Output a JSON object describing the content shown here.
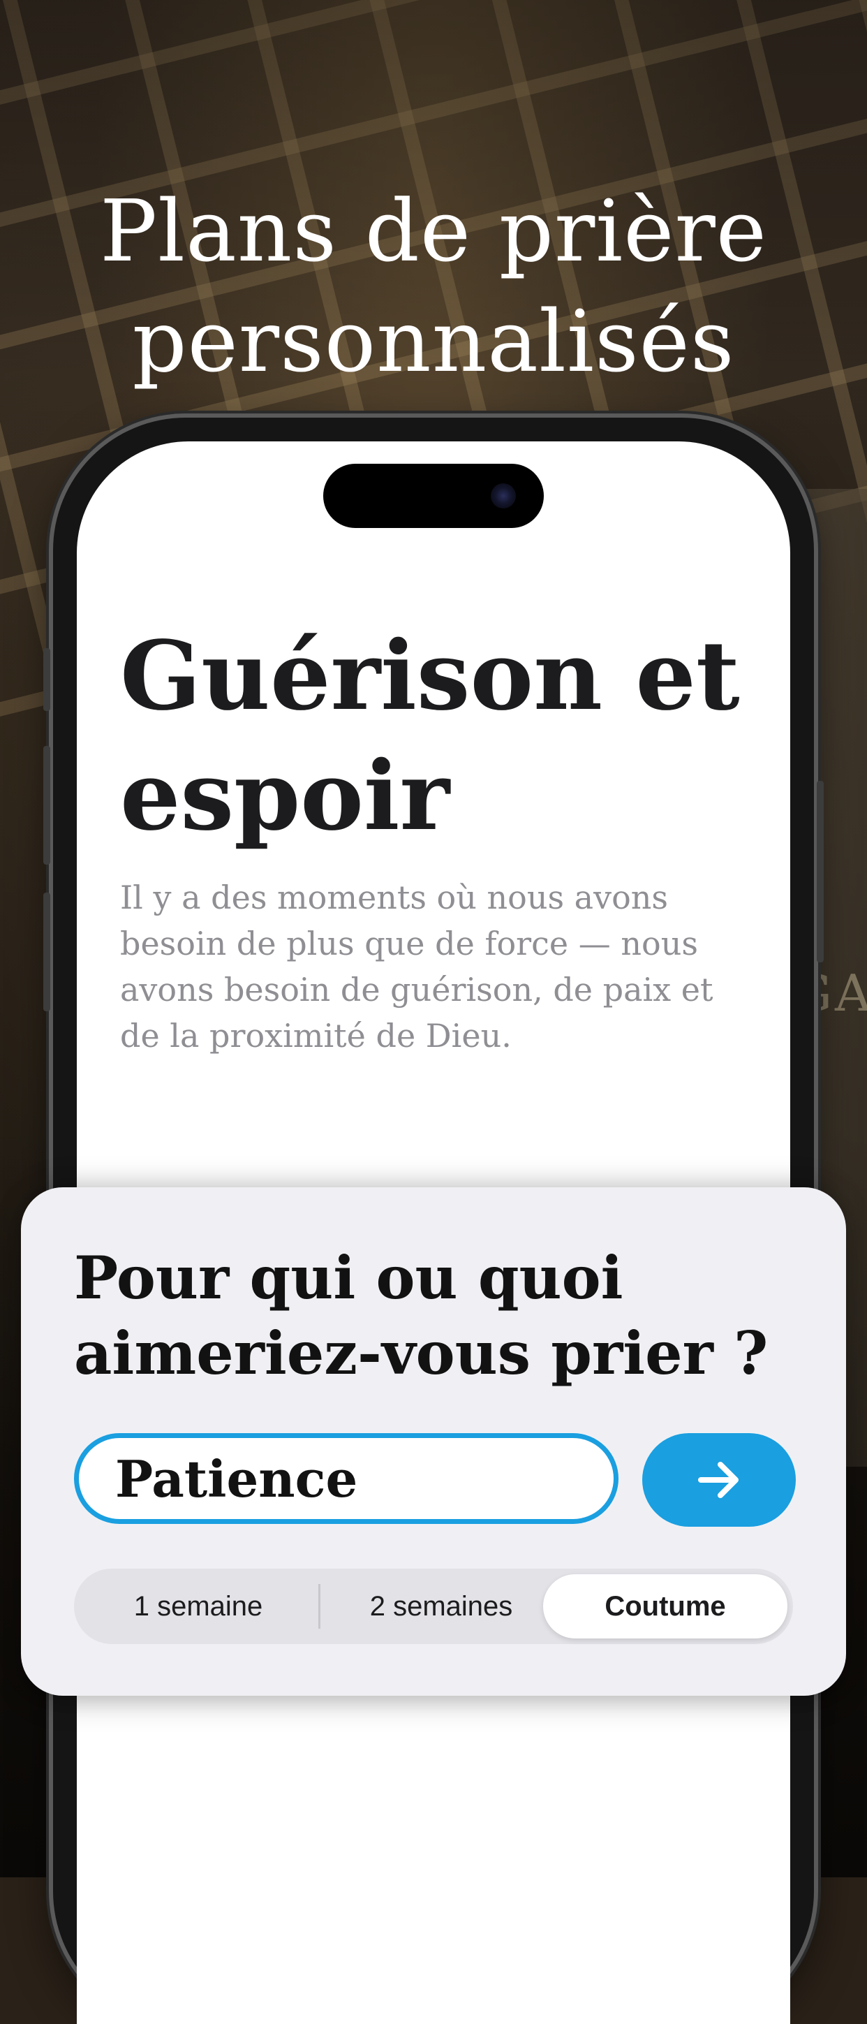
{
  "headline": {
    "line1": "Plans de prière",
    "line2": "personnalisés"
  },
  "background": {
    "wall_text": "GA"
  },
  "plan": {
    "title_line1": "Guérison et",
    "title_line2": "espoir",
    "description": "Il y a des moments où nous avons besoin de plus que de force — nous avons besoin de guérison, de paix et de la proximité de Dieu."
  },
  "prompt": {
    "question_line1": "Pour qui ou quoi",
    "question_line2": "aimeriez-vous prier ?",
    "input_value": "Patience",
    "submit_icon": "arrow-right-icon"
  },
  "duration": {
    "options": [
      "1 semaine",
      "2 semaines",
      "Coutume"
    ],
    "selected": "Coutume"
  },
  "colors": {
    "accent": "#1a9fe0",
    "title": "#1c1c1e",
    "description": "#8e8e93",
    "sheet_background": "#f0f0f4"
  }
}
